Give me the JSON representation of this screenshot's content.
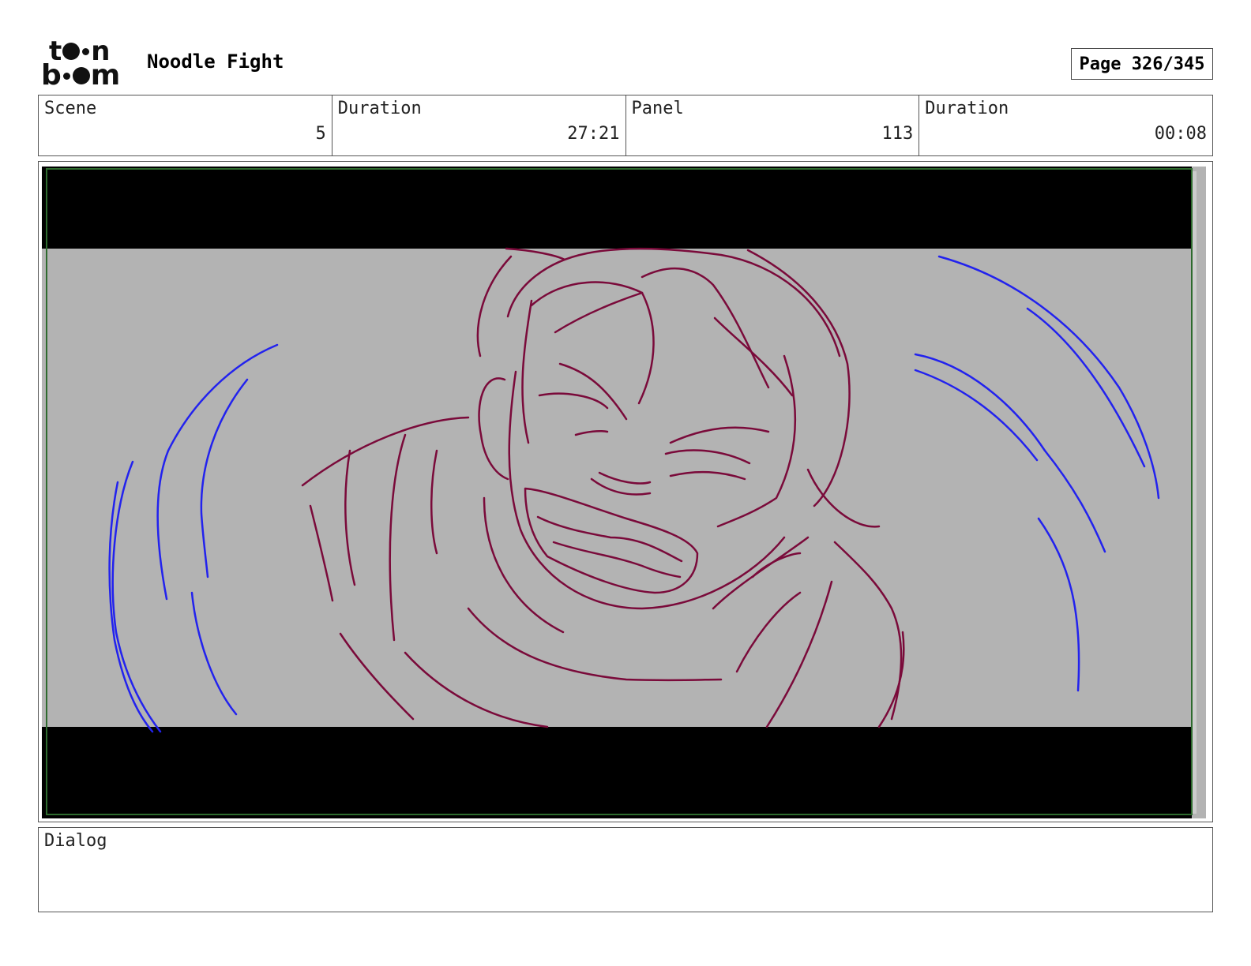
{
  "header": {
    "logo_top": [
      "t",
      "n"
    ],
    "logo_bottom": [
      "b",
      "m"
    ],
    "project_title": "Noodle Fight",
    "page_label": "Page 326/345"
  },
  "info": {
    "scene": {
      "label": "Scene",
      "value": "5"
    },
    "scene_duration": {
      "label": "Duration",
      "value": "27:21"
    },
    "panel": {
      "label": "Panel",
      "value": "113"
    },
    "panel_duration": {
      "label": "Duration",
      "value": "00:08"
    }
  },
  "panel_art": {
    "background_color": "#b3b3b3",
    "letterbox_color": "#000000",
    "sketch_color": "#7a0a3a",
    "action_lines_color": "#2222ee",
    "frame_border_color": "#2e6b2e"
  },
  "dialog": {
    "label": "Dialog",
    "value": ""
  }
}
